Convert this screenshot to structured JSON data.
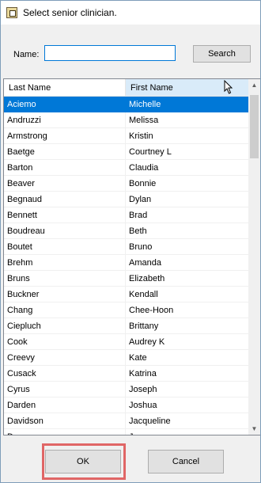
{
  "window": {
    "title": "Select senior clinician."
  },
  "search": {
    "label": "Name:",
    "value": "",
    "placeholder": "",
    "button_label": "Search"
  },
  "grid": {
    "columns": [
      "Last Name",
      "First Name"
    ],
    "selected_row": 0,
    "rows": [
      [
        "Aciemo",
        "Michelle"
      ],
      [
        "Andruzzi",
        "Melissa"
      ],
      [
        "Armstrong",
        "Kristin"
      ],
      [
        "Baetge",
        "Courtney L"
      ],
      [
        "Barton",
        "Claudia"
      ],
      [
        "Beaver",
        "Bonnie"
      ],
      [
        "Begnaud",
        "Dylan"
      ],
      [
        "Bennett",
        "Brad"
      ],
      [
        "Boudreau",
        "Beth"
      ],
      [
        "Boutet",
        "Bruno"
      ],
      [
        "Brehm",
        "Amanda"
      ],
      [
        "Bruns",
        "Elizabeth"
      ],
      [
        "Buckner",
        "Kendall"
      ],
      [
        "Chang",
        "Chee-Hoon"
      ],
      [
        "Ciepluch",
        "Brittany"
      ],
      [
        "Cook",
        "Audrey K"
      ],
      [
        "Creevy",
        "Kate"
      ],
      [
        "Cusack",
        "Katrina"
      ],
      [
        "Cyrus",
        "Joseph"
      ],
      [
        "Darden",
        "Joshua"
      ],
      [
        "Davidson",
        "Jacqueline"
      ],
      [
        "D",
        "J"
      ]
    ]
  },
  "buttons": {
    "ok": "OK",
    "cancel": "Cancel"
  },
  "colors": {
    "selection": "#0078d7",
    "highlight": "#e06666",
    "header_active": "#d9ebf9"
  }
}
